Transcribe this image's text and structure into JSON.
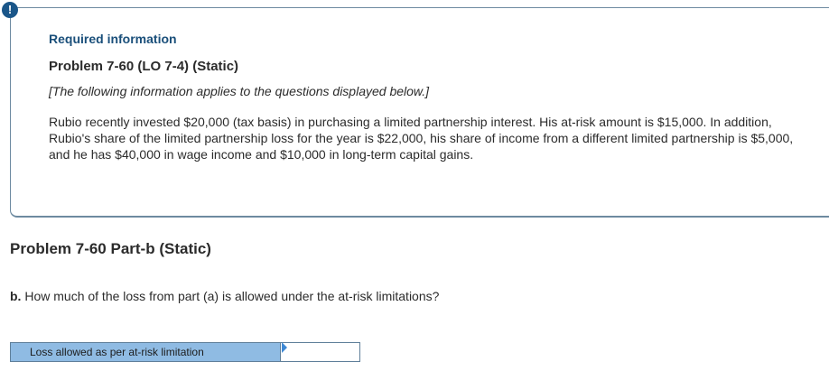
{
  "alert": {
    "icon": "alert-icon",
    "symbol": "!"
  },
  "info": {
    "heading": "Required information",
    "problem_title": "Problem 7-60 (LO 7-4) (Static)",
    "note": "[The following information applies to the questions displayed below.]",
    "paragraph": "Rubio recently invested $20,000 (tax basis) in purchasing a limited partnership interest. His at-risk amount is $15,000. In addition, Rubio's share of the limited partnership loss for the year is $22,000, his share of income from a different limited partnership is $5,000, and he has $40,000 in wage income and $10,000 in long-term capital gains."
  },
  "part": {
    "title": "Problem 7-60 Part-b (Static)",
    "question_prefix": "b.",
    "question_text": " How much of the loss from part (a) is allowed under the at-risk limitations?"
  },
  "answer": {
    "label": "Loss allowed as per at-risk limitation",
    "value": ""
  },
  "colors": {
    "accent": "#1a5689",
    "label_bg": "#8fbbe3",
    "border": "#6d8aa0"
  }
}
